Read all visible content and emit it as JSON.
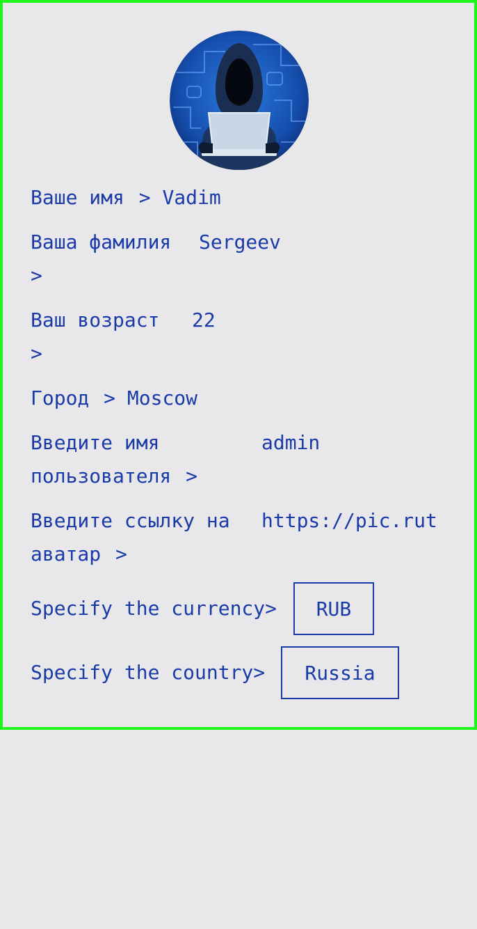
{
  "avatar": {
    "icon": "hacker-avatar-icon"
  },
  "fields": {
    "name": {
      "label": "Ваше имя",
      "arrow": ">",
      "value": "Vadim"
    },
    "surname": {
      "label": "Ваша фамилия",
      "arrow": ">",
      "value": "Sergeev"
    },
    "age": {
      "label": "Ваш возраст",
      "arrow": ">",
      "value": "22"
    },
    "city": {
      "label": "Город",
      "arrow": ">",
      "value": "Moscow"
    },
    "username": {
      "label_line1": "Введите имя",
      "label_line2": "пользователя",
      "arrow": ">",
      "value": "admin"
    },
    "avatar_link": {
      "label_line1": "Введите ссылку на",
      "label_line2": "аватар",
      "arrow": ">",
      "value": "https://pic.rut"
    },
    "currency": {
      "label": "Specify the currency>",
      "value": "RUB"
    },
    "country": {
      "label": "Specify the country>",
      "value": "Russia"
    }
  },
  "colors": {
    "text": "#1a3aa8",
    "background": "#e8e7ea",
    "frame": "#1df51d"
  }
}
